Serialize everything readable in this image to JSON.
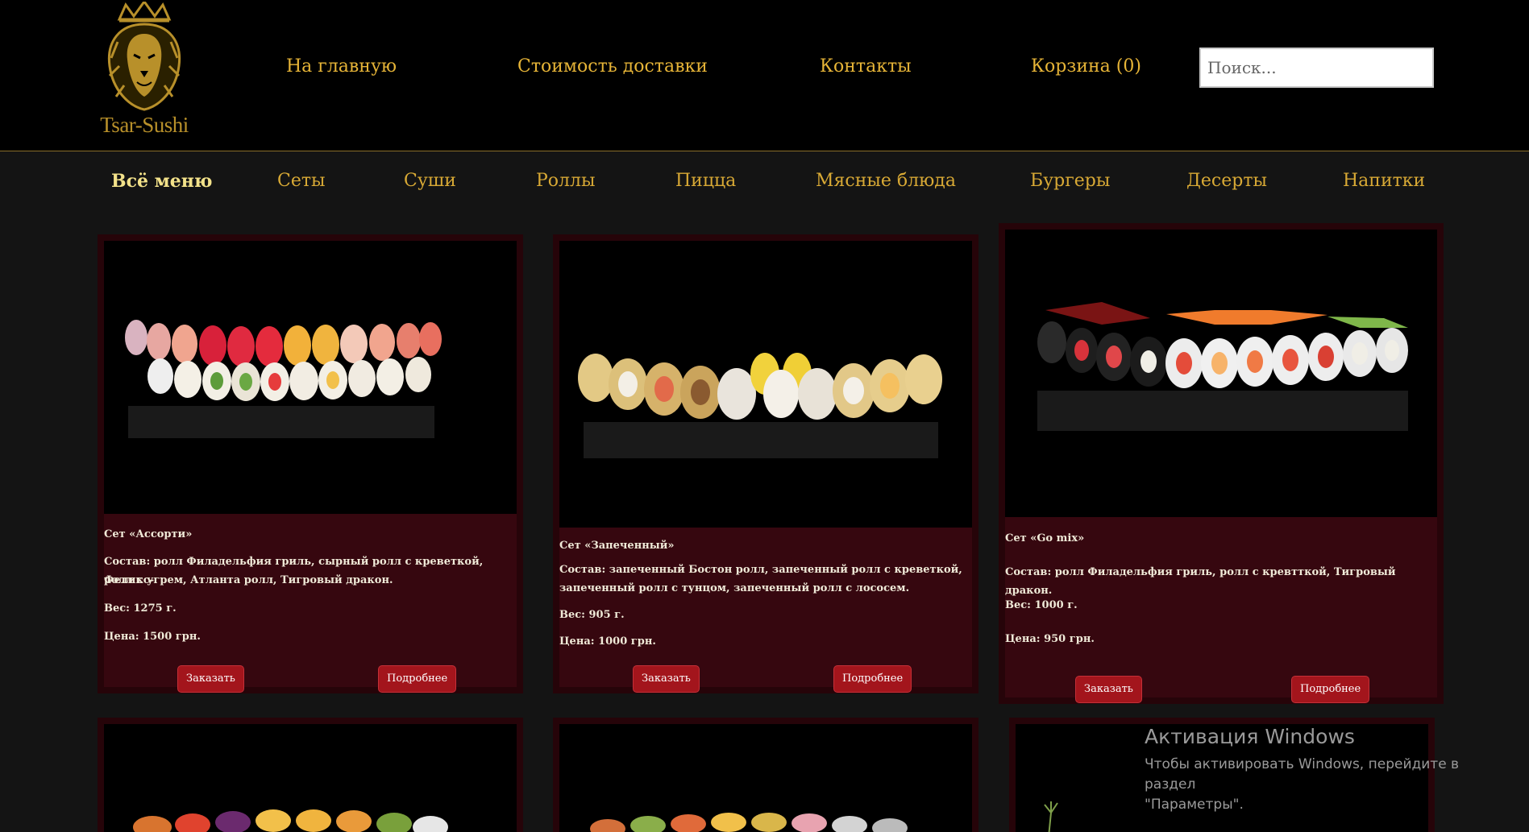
{
  "brand": {
    "name": "Tsar-Sushi",
    "gold": "#b8902a"
  },
  "topnav": {
    "home": "На главную",
    "delivery": "Стоимость доставки",
    "contacts": "Контакты",
    "cart": "Корзина (0)"
  },
  "search": {
    "placeholder": "Поиск..."
  },
  "categories": [
    "Всё меню",
    "Сеты",
    "Суши",
    "Роллы",
    "Пицца",
    "Мясные блюда",
    "Бургеры",
    "Десерты",
    "Напитки"
  ],
  "cards": [
    {
      "title": "Сет «Ассорти»",
      "composition_line1": "Состав: ролл Филадельфия гриль, сырный ролл с креветкой, Феликс-",
      "composition_line2": "ролл с угрем, Атланта ролл, Тигровый дракон.",
      "weight": "Вес: 1275 г.",
      "price": "Цена: 1500 грн.",
      "order": "Заказать",
      "details": "Подробнее"
    },
    {
      "title": "Сет «Запеченный»",
      "composition_line1": "Состав: запеченный Бостон ролл, запеченный ролл с креветкой,",
      "composition_line2": "запеченный ролл с тунцом, запеченный ролл с лососем.",
      "weight": "Вес: 905 г.",
      "price": "Цена: 1000 грн.",
      "order": "Заказать",
      "details": "Подробнее"
    },
    {
      "title": "Сет «Go mix»",
      "composition_line1": "Состав: ролл Филадельфия гриль, ролл с кревтткой, Тигровый дракон.",
      "composition_line2": "",
      "weight": "Вес: 1000 г.",
      "price": "Цена: 950 грн.",
      "order": "Заказать",
      "details": "Подробнее"
    }
  ],
  "windows_activation": {
    "title": "Активация Windows",
    "line1": "Чтобы активировать Windows, перейдите в раздел",
    "line2": "\"Параметры\"."
  },
  "colors": {
    "accent": "#e6b437",
    "card_bg": "#36070f",
    "button": "#a3151c"
  }
}
